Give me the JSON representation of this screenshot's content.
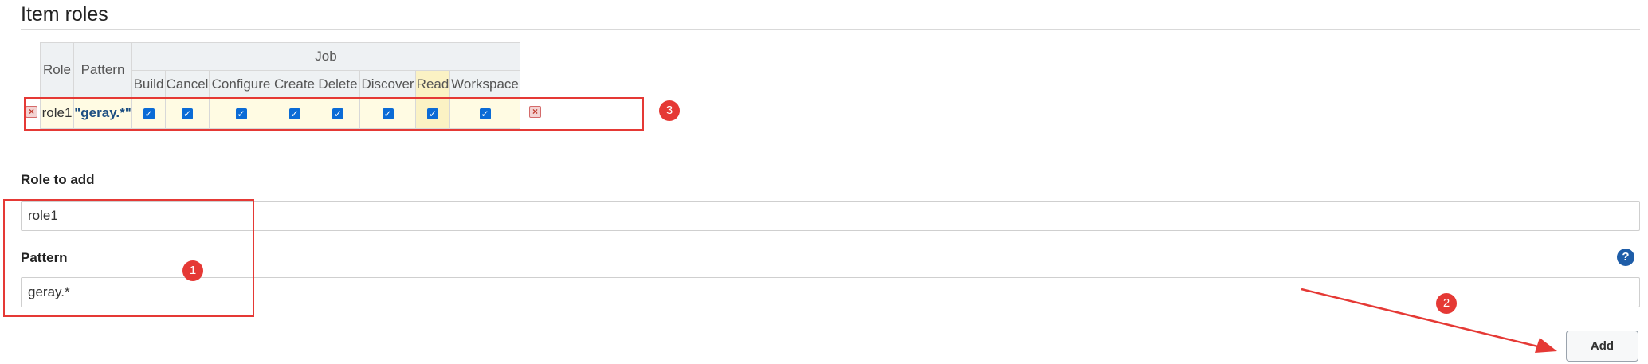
{
  "section": {
    "title": "Item roles"
  },
  "table": {
    "col_role": "Role",
    "col_pattern": "Pattern",
    "group": "Job",
    "permissions": [
      "Build",
      "Cancel",
      "Configure",
      "Create",
      "Delete",
      "Discover",
      "Read",
      "Workspace"
    ],
    "rows": [
      {
        "role": "role1",
        "pattern": "\"geray.*\"",
        "checked": [
          true,
          true,
          true,
          true,
          true,
          true,
          true,
          true
        ]
      }
    ]
  },
  "form": {
    "role_label": "Role to add",
    "role_value": "role1",
    "pattern_label": "Pattern",
    "pattern_value": "geray.*",
    "help_glyph": "?",
    "add_label": "Add"
  },
  "annotations": {
    "badge1": "1",
    "badge2": "2",
    "badge3": "3",
    "color": "#e53935"
  },
  "icons": {
    "delete": "x-icon",
    "help": "question-mark-icon",
    "check": "checkmark"
  }
}
